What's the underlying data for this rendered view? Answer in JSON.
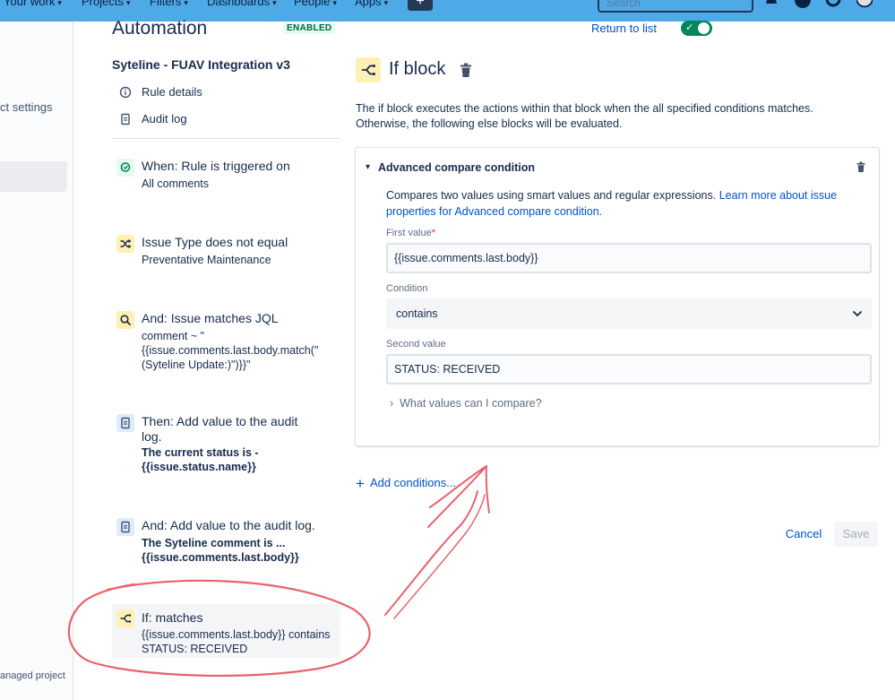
{
  "nav": {
    "items": [
      "Your work",
      "Projects",
      "Filters",
      "Dashboards",
      "People",
      "Apps"
    ],
    "plus": "+",
    "search_placeholder": "Search",
    "icons": [
      "notification-icon",
      "help-icon",
      "settings-icon",
      "avatar"
    ]
  },
  "sidebar": {
    "settings_label": "ct settings",
    "footer_label": "anaged project"
  },
  "rule": {
    "heading": "Automation",
    "badge": "ENABLED",
    "name": "Syteline - FUAV Integration v3",
    "links": {
      "details": "Rule details",
      "audit": "Audit log"
    },
    "components": {
      "trigger": {
        "title": "When: Rule is triggered on",
        "sub": "All comments",
        "icon": "trigger-icon"
      },
      "issue_type": {
        "title": "Issue Type does not equal",
        "sub": "Preventative Maintenance",
        "icon": "shuffle-icon"
      },
      "jql": {
        "title": "And: Issue matches JQL",
        "sub": "comment ~ \"{{issue.comments.last.body.match(\"(Syteline Update:)\")}}\"",
        "icon": "search-icon"
      },
      "audit1": {
        "title": "Then: Add value to the audit log.",
        "sub": "The current status is - {{issue.status.name}}",
        "icon": "document-icon"
      },
      "audit2": {
        "title": "And: Add value to the audit log.",
        "sub": "The Syteline comment is ... {{issue.comments.last.body}}",
        "icon": "document-icon"
      },
      "ifmatch": {
        "title": "If: matches",
        "sub": "{{issue.comments.last.body}} contains STATUS: RECEIVED",
        "icon": "branch-icon"
      }
    }
  },
  "panel": {
    "return_link": "Return to list",
    "toggle_on": true,
    "title": "If block",
    "description": "The if block executes the actions within that block when the all specified conditions matches. Otherwise, the following else blocks will be evaluated.",
    "condition": {
      "title": "Advanced compare condition",
      "desc_prefix": "Compares two values using smart values and regular expressions. ",
      "desc_link": "Learn more about issue properties for Advanced compare condition.",
      "first_label": "First value",
      "required_marker": "*",
      "first_value": "{{issue.comments.last.body}}",
      "condition_label": "Condition",
      "condition_value": "contains",
      "second_label": "Second value",
      "second_value": "STATUS: RECEIVED",
      "what_values": "What values can I compare?"
    },
    "add_conditions": "Add conditions...",
    "cancel": "Cancel",
    "save": "Save"
  },
  "colors": {
    "nav_bg": "#4ea9e7",
    "link": "#0052cc",
    "enabled_bg": "#e3fcef",
    "enabled_text": "#006644",
    "toggle": "#00875a",
    "annotation": "#e8626c"
  }
}
